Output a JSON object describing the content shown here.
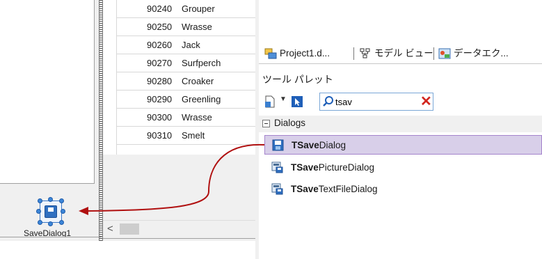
{
  "designer": {
    "component_label": "SaveDialog1"
  },
  "grid": {
    "rows": [
      {
        "code": "90240",
        "name": "Grouper"
      },
      {
        "code": "90250",
        "name": "Wrasse"
      },
      {
        "code": "90260",
        "name": "Jack"
      },
      {
        "code": "90270",
        "name": "Surfperch"
      },
      {
        "code": "90280",
        "name": "Croaker"
      },
      {
        "code": "90290",
        "name": "Greenling"
      },
      {
        "code": "90300",
        "name": "Wrasse"
      },
      {
        "code": "90310",
        "name": "Smelt"
      }
    ],
    "scroll_left_glyph": "<"
  },
  "tabs": [
    {
      "label": "Project1.d...",
      "icon": "project-manager-icon"
    },
    {
      "label": "モデル ビュー",
      "icon": "model-view-icon"
    },
    {
      "label": "データエク...",
      "icon": "data-explorer-icon"
    }
  ],
  "palette": {
    "title": "ツール パレット",
    "search": {
      "value": "tsav",
      "placeholder": ""
    },
    "category": "Dialogs",
    "items": [
      {
        "bold": "TSave",
        "rest": "Dialog",
        "selected": true
      },
      {
        "bold": "TSave",
        "rest": "PictureDialog",
        "selected": false
      },
      {
        "bold": "TSave",
        "rest": "TextFileDialog",
        "selected": false
      }
    ]
  },
  "colors": {
    "selection_fill": "#d8cfe9",
    "selection_border": "#a584cc",
    "arrow": "#b01010",
    "clear_x": "#d2261f"
  }
}
